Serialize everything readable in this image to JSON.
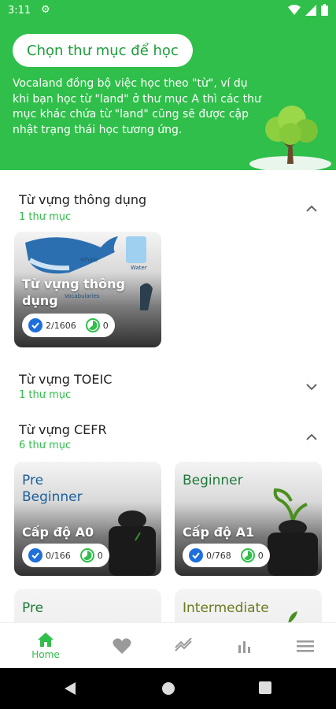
{
  "status_bar": {
    "time": "3:11"
  },
  "header": {
    "title": "Chọn thư mục để học",
    "description": "Vocaland đồng bộ việc học theo \"từ\", ví dụ khi bạn học từ \"land\" ở thư mục A thì các thư mục khác chứa từ \"land\" cũng sẽ được cập nhật trạng thái học tương ứng."
  },
  "sections": [
    {
      "title": "Từ vựng thông dụng",
      "subtitle": "1 thư mục"
    },
    {
      "title": "Từ vựng TOEIC",
      "subtitle": "1 thư mục"
    },
    {
      "title": "Từ vựng CEFR",
      "subtitle": "6 thư mục"
    }
  ],
  "cards": {
    "common": {
      "name": "Từ vựng thông dụng",
      "learned": "2/1606",
      "mastered": "0",
      "illustration_labels": [
        "Whale",
        "Water",
        "Vocabularies"
      ]
    },
    "a0": {
      "level": "Pre Beginner",
      "name": "Cấp độ A0",
      "learned": "0/166",
      "mastered": "0"
    },
    "a1": {
      "level": "Beginner",
      "name": "Cấp độ A1",
      "learned": "0/768",
      "mastered": "0"
    },
    "a2": {
      "level": "Pre"
    },
    "b1": {
      "level": "Intermediate"
    }
  },
  "bottom_nav": {
    "home_label": "Home"
  },
  "colors": {
    "primary": "#2fbf4a",
    "check_blue": "#1e6fd9",
    "text": "#222222"
  }
}
